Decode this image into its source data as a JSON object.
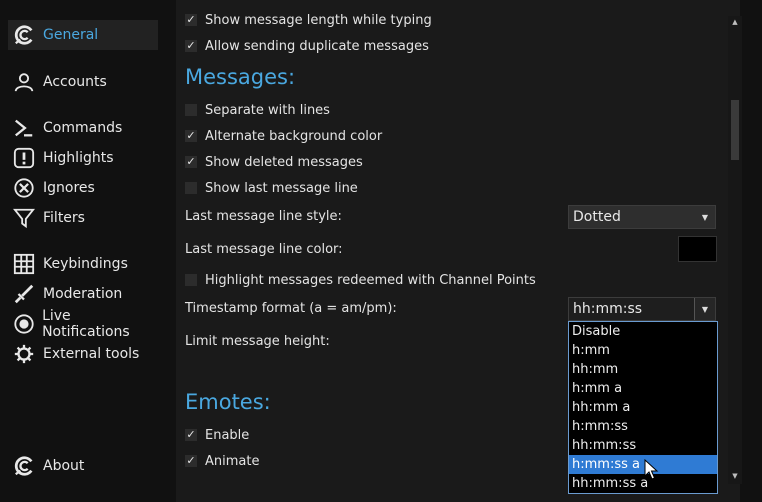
{
  "sidebar": {
    "items": [
      {
        "label": "General",
        "icon": "chatterino-icon",
        "active": true
      },
      {
        "label": "Accounts",
        "icon": "user-icon"
      },
      {
        "label": "Commands",
        "icon": "terminal-icon"
      },
      {
        "label": "Highlights",
        "icon": "exclamation-icon"
      },
      {
        "label": "Ignores",
        "icon": "ignore-icon"
      },
      {
        "label": "Filters",
        "icon": "filter-icon"
      },
      {
        "label": "Keybindings",
        "icon": "keyboard-icon"
      },
      {
        "label": "Moderation",
        "icon": "sword-icon"
      },
      {
        "label": "Live Notifications",
        "icon": "live-icon"
      },
      {
        "label": "External tools",
        "icon": "gear-icon"
      },
      {
        "label": "About",
        "icon": "chatterino-icon"
      }
    ]
  },
  "settings": {
    "top": [
      {
        "label": "Show message length while typing",
        "checked": true
      },
      {
        "label": "Allow sending duplicate messages",
        "checked": true
      }
    ],
    "messages_title": "Messages:",
    "messages": [
      {
        "label": "Separate with lines",
        "checked": false
      },
      {
        "label": "Alternate background color",
        "checked": true
      },
      {
        "label": "Show deleted messages",
        "checked": true
      },
      {
        "label": "Show last message line",
        "checked": false
      }
    ],
    "last_line_style_label": "Last message line style:",
    "last_line_style_value": "Dotted",
    "last_line_color_label": "Last message line color:",
    "last_line_color_value": "#000000",
    "highlight_redeemed": {
      "label": "Highlight messages redeemed with Channel Points",
      "checked": false
    },
    "timestamp_label": "Timestamp format (a = am/pm):",
    "timestamp_value": "hh:mm:ss",
    "timestamp_options": [
      "Disable",
      "h:mm",
      "hh:mm",
      "h:mm a",
      "hh:mm a",
      "h:mm:ss",
      "hh:mm:ss",
      "h:mm:ss a",
      "hh:mm:ss a"
    ],
    "timestamp_highlighted": "h:mm:ss a",
    "limit_height_label": "Limit message height:",
    "emotes_title": "Emotes:",
    "emotes": [
      {
        "label": "Enable",
        "checked": true
      },
      {
        "label": "Animate",
        "checked": true
      }
    ]
  },
  "colors": {
    "accent": "#4aa8e0",
    "selection": "#2f7bd4",
    "background": "#1a1a1a",
    "sidebar": "#111111"
  }
}
